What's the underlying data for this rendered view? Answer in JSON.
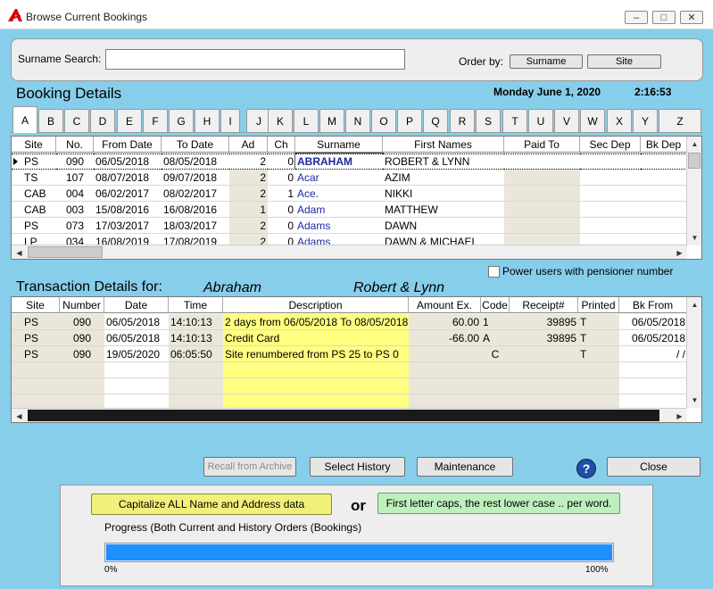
{
  "window": {
    "title": "Browse Current Bookings",
    "min_icon": "minimize-icon",
    "max_icon": "maximize-icon",
    "close_icon": "close-icon"
  },
  "search": {
    "label": "Surname Search:",
    "value": "",
    "order_by_label": "Order by:",
    "order_surname": "Surname",
    "order_site": "Site"
  },
  "booking": {
    "heading": "Booking Details",
    "date": "Monday June 1, 2020",
    "time": "2:16:53"
  },
  "tabs": [
    "A",
    "B",
    "C",
    "D",
    "E",
    "F",
    "G",
    "H",
    "I",
    "J",
    "K",
    "L",
    "M",
    "N",
    "O",
    "P",
    "Q",
    "R",
    "S",
    "T",
    "U",
    "V",
    "W",
    "X",
    "Y",
    "Z"
  ],
  "active_tab": "A",
  "bookings": {
    "columns": [
      "Site",
      "No.",
      "From Date",
      "To Date",
      "Ad",
      "Ch",
      "Surname",
      "First Names",
      "Paid To",
      "Sec Dep",
      "Bk Dep"
    ],
    "rows": [
      {
        "site": "PS",
        "no": "090",
        "from": "06/05/2018",
        "to": "08/05/2018",
        "ad": "2",
        "ch": "0",
        "surname": "ABRAHAM",
        "first": "ROBERT & LYNN",
        "selected": true
      },
      {
        "site": "TS",
        "no": "107",
        "from": "08/07/2018",
        "to": "09/07/2018",
        "ad": "2",
        "ch": "0",
        "surname": "Acar",
        "first": "AZIM"
      },
      {
        "site": "CAB",
        "no": "004",
        "from": "06/02/2017",
        "to": "08/02/2017",
        "ad": "2",
        "ch": "1",
        "surname": "Ace.",
        "first": "NIKKI"
      },
      {
        "site": "CAB",
        "no": "003",
        "from": "15/08/2016",
        "to": "16/08/2016",
        "ad": "1",
        "ch": "0",
        "surname": "Adam",
        "first": "MATTHEW"
      },
      {
        "site": "PS",
        "no": "073",
        "from": "17/03/2017",
        "to": "18/03/2017",
        "ad": "2",
        "ch": "0",
        "surname": "Adams",
        "first": "DAWN"
      },
      {
        "site": "LP",
        "no": "034",
        "from": "16/08/2019",
        "to": "17/08/2019",
        "ad": "2",
        "ch": "0",
        "surname": "Adams",
        "first": "DAWN & MICHAEL"
      }
    ]
  },
  "pensioner": {
    "label": "Power users with pensioner number",
    "checked": false
  },
  "transactions": {
    "heading": "Transaction Details for:",
    "surname": "Abraham",
    "first": "Robert & Lynn",
    "columns": [
      "Site",
      "Number",
      "Date",
      "Time",
      "Description",
      "Amount Ex.",
      "Code",
      "Receipt#",
      "Printed",
      "Bk From"
    ],
    "rows": [
      {
        "site": "PS",
        "number": "090",
        "date": "06/05/2018",
        "time": "14:10:13",
        "desc": "2 days from 06/05/2018 To 08/05/2018",
        "amount": "60.00",
        "code": "1",
        "receipt": "39895",
        "printed": "T",
        "bkfrom": "06/05/2018"
      },
      {
        "site": "PS",
        "number": "090",
        "date": "06/05/2018",
        "time": "14:10:13",
        "desc": "Credit Card",
        "amount": "-66.00",
        "code": "A",
        "receipt": "39895",
        "printed": "T",
        "bkfrom": "06/05/2018"
      },
      {
        "site": "PS",
        "number": "090",
        "date": "19/05/2020",
        "time": "06:05:50",
        "desc": "Site renumbered from PS  25 to PS  0",
        "amount": "",
        "code": "C",
        "receipt": "",
        "printed": "T",
        "bkfrom": "/ /"
      }
    ]
  },
  "buttons": {
    "recall": "Recall from Archive",
    "select_history": "Select History",
    "maintenance": "Maintenance",
    "close": "Close",
    "help_icon": "help-icon"
  },
  "lower": {
    "capitalize": "Capitalize ALL Name and Address data",
    "or": "or",
    "first_caps": "First letter caps, the rest lower case .. per word.",
    "progress_label": "Progress (Both Current and History Orders (Bookings)",
    "progress_value": 1.0,
    "progress_min": "0%",
    "progress_max": "100%"
  },
  "colors": {
    "background": "#87CEEB",
    "highlight_yellow": "#FFFF80",
    "shaded": "#EAE6D9",
    "surname_blue": "#1a2a9a",
    "progress": "#1E90FF"
  }
}
